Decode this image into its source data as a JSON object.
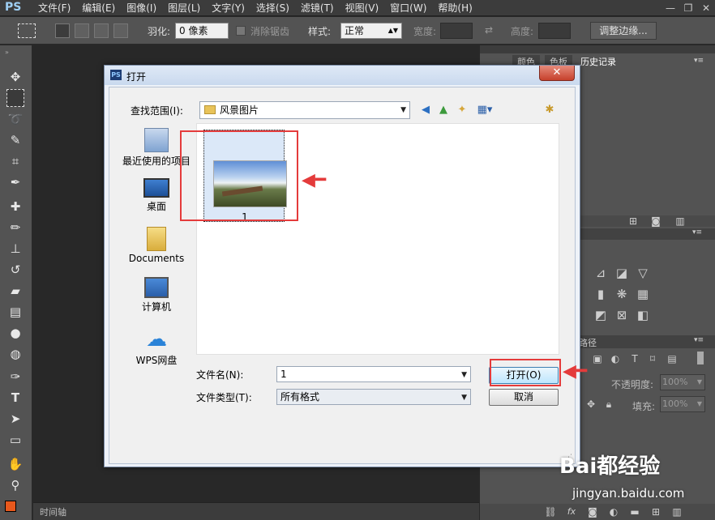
{
  "app": {
    "logo": "PS"
  },
  "menu": [
    "文件(F)",
    "编辑(E)",
    "图像(I)",
    "图层(L)",
    "文字(Y)",
    "选择(S)",
    "滤镜(T)",
    "视图(V)",
    "窗口(W)",
    "帮助(H)"
  ],
  "window_controls": {
    "minimize": "—",
    "restore": "❐",
    "close": "✕"
  },
  "options_bar": {
    "feather_label": "羽化:",
    "feather_value": "0 像素",
    "antialias_label": "消除锯齿",
    "style_label": "样式:",
    "style_value": "正常",
    "width_label": "宽度:",
    "height_label": "高度:",
    "refine_edge_label": "调整边缘..."
  },
  "timeline_tab": "时间轴",
  "right_panel": {
    "tabs": [
      "颜色",
      "色板",
      "历史记录"
    ],
    "active_tab": "历史记录",
    "paths_label": "路径",
    "opacity_label": "不透明度:",
    "opacity_value": "100%",
    "fill_label": "填充:",
    "fill_value": "100%"
  },
  "dialog": {
    "title": "打开",
    "lookin_label": "查找范围(I):",
    "lookin_value": "风景图片",
    "places": [
      "最近使用的项目",
      "桌面",
      "Documents",
      "计算机",
      "WPS网盘"
    ],
    "files": [
      {
        "name": "1"
      }
    ],
    "filename_label": "文件名(N):",
    "filename_value": "1",
    "filetype_label": "文件类型(T):",
    "filetype_value": "所有格式",
    "open_button": "打开(O)",
    "cancel_button": "取消",
    "close_button": "✕"
  },
  "watermark": {
    "brand": "Bai都经验",
    "url": "jingyan.baidu.com"
  },
  "colors": {
    "annotation_red": "#e43b3b",
    "ps_dark": "#282828",
    "panel_gray": "#535353"
  }
}
